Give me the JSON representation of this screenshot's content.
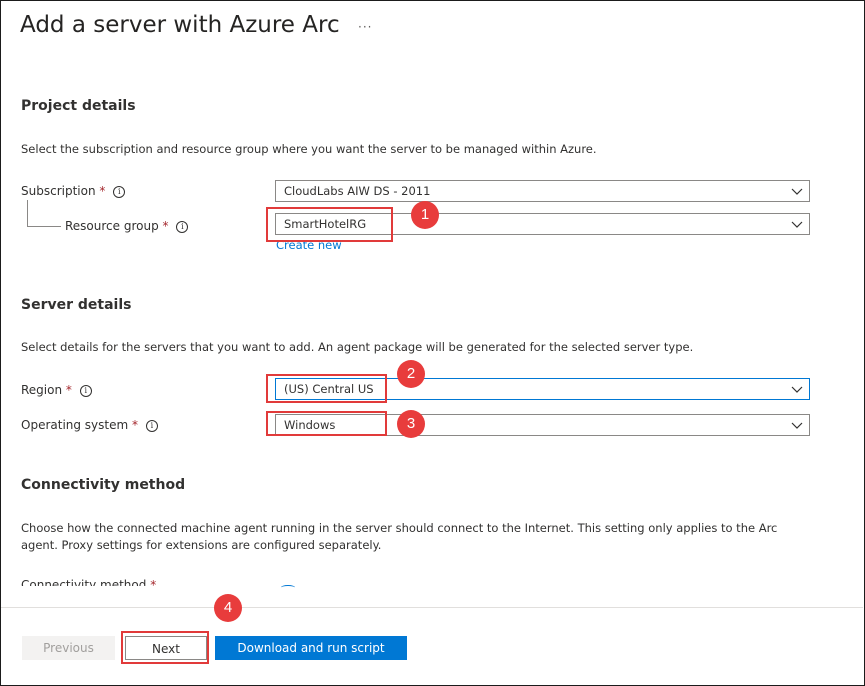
{
  "header": {
    "title": "Add a server with Azure Arc",
    "more_label": "···"
  },
  "project": {
    "section_title": "Project details",
    "description": "Select the subscription and resource group where you want the server to be managed within Azure.",
    "subscription_label": "Subscription",
    "subscription_value": "CloudLabs AIW DS - 2011",
    "resource_group_label": "Resource group",
    "resource_group_value": "SmartHotelRG",
    "create_new_link": "Create new"
  },
  "server": {
    "section_title": "Server details",
    "description": "Select details for the servers that you want to add. An agent package will be generated for the selected server type.",
    "region_label": "Region",
    "region_value": "(US) Central US",
    "os_label": "Operating system",
    "os_value": "Windows"
  },
  "connectivity": {
    "section_title": "Connectivity method",
    "description_line1": "Choose how the connected machine agent running in the server should connect to the Internet. This setting only applies to the Arc",
    "description_line2": "agent. Proxy settings for extensions are configured separately.",
    "method_label": "Connectivity method"
  },
  "common": {
    "required_mark": "*",
    "info_glyph": "i"
  },
  "footer": {
    "previous_label": "Previous",
    "next_label": "Next",
    "download_label": "Download and run script"
  },
  "callouts": [
    "1",
    "2",
    "3",
    "4"
  ],
  "colors": {
    "accent": "#0078d4",
    "callout": "#e13a3a",
    "required": "#a4262c"
  }
}
